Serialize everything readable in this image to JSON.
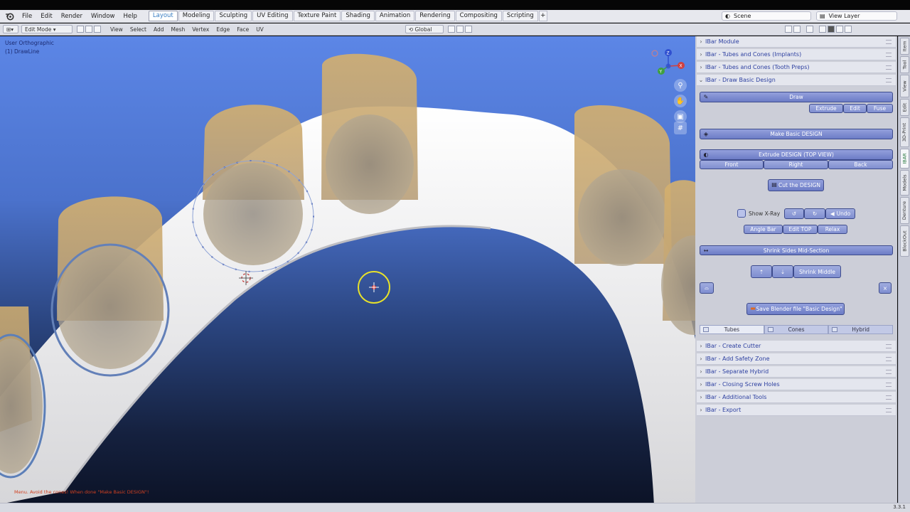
{
  "menu": {
    "items": [
      "File",
      "Edit",
      "Render",
      "Window",
      "Help"
    ]
  },
  "workspaces": {
    "tabs": [
      "Layout",
      "Modeling",
      "Sculpting",
      "UV Editing",
      "Texture Paint",
      "Shading",
      "Animation",
      "Rendering",
      "Compositing",
      "Scripting"
    ],
    "active": "Layout",
    "add": "+"
  },
  "scene": {
    "name": "Scene"
  },
  "view_layer": {
    "name": "View Layer"
  },
  "header": {
    "mode": "Edit Mode",
    "menus": [
      "View",
      "Select",
      "Add",
      "Mesh",
      "Vertex",
      "Edge",
      "Face",
      "UV"
    ],
    "orientation": "Global"
  },
  "viewport": {
    "view_name": "User Orthographic",
    "object_name": "(1) DrawLine",
    "status_message": "Menu. Avoid the cones! When done \"Make Basic DESIGN\"!",
    "gizmo": {
      "x": "X",
      "y": "Y",
      "z": "Z"
    },
    "colors": {
      "tooth": "#c9a566",
      "gum": "#f2f2f2",
      "select_ring": "#e8e22a",
      "bg_top": "#5c86e6",
      "bg_bottom": "#0c1327"
    }
  },
  "panel": {
    "sections_top": [
      "IBar Module",
      "IBar - Tubes and Cones (Implants)",
      "IBar - Tubes and Cones (Tooth Preps)",
      "IBar - Draw Basic Design"
    ],
    "draw_basic": {
      "draw": "Draw",
      "extrude": "Extrude",
      "edit": "Edit",
      "fuse": "Fuse",
      "make_basic": "Make  Basic DESIGN",
      "extrude_design": "Extrude  DESIGN (TOP VIEW)",
      "front": "Front",
      "right": "Right",
      "back": "Back",
      "cut_design": "Cut the DESIGN",
      "show_xray": "Show X-Ray",
      "undo": "Undo",
      "angle_bar": "Angle Bar",
      "edit_top": "Edit TOP",
      "relax": "Relax",
      "shrink_sides": "Shrink Sides Mid-Section",
      "shrink_middle": "Shrink Middle",
      "save_blend": "Save Blender file \"Basic Design\"",
      "close": "×"
    },
    "tabs": [
      "Tubes",
      "Cones",
      "Hybrid"
    ],
    "active_tab": "Tubes",
    "sections_bottom": [
      "IBar - Create Cutter",
      "IBar - Add Safety Zone",
      "IBar - Separate Hybrid",
      "IBar - Closing Screw Holes",
      "IBar - Additional Tools",
      "IBar - Export"
    ]
  },
  "side_tabs": [
    "Item",
    "Tool",
    "View",
    "Edit",
    "3D-Print",
    "IBAR",
    "Models",
    "Denture",
    "BlockOut"
  ],
  "active_side_tab": "IBAR",
  "version": "3.3.1"
}
